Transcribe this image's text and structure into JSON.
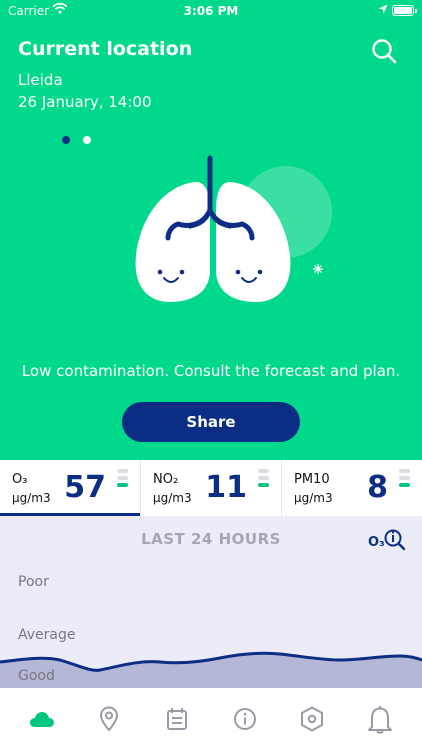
{
  "status_bar": {
    "carrier": "Carrier",
    "time": "3:06 PM"
  },
  "header": {
    "title": "Current location",
    "city": "Lleida",
    "datetime": "26 January, 14:00"
  },
  "pager": {
    "total": 2,
    "active_index": 0
  },
  "message": "Low contamination. Consult the forecast and plan.",
  "share_label": "Share",
  "pollutants": [
    {
      "name": "O₃",
      "unit": "μg/m3",
      "value": "57",
      "active": true
    },
    {
      "name": "NO₂",
      "unit": "μg/m3",
      "value": "11",
      "active": false
    },
    {
      "name": "PM10",
      "unit": "μg/m3",
      "value": "8",
      "active": false
    }
  ],
  "chart": {
    "title": "LAST 24 HOURS",
    "info_label": "O₃",
    "levels": [
      "Poor",
      "Average",
      "Good"
    ]
  },
  "tabbar": [
    "cloud-icon",
    "location-pin-icon",
    "calendar-icon",
    "info-icon",
    "hexagon-icon",
    "bell-icon"
  ],
  "colors": {
    "accent_green": "#00d98b",
    "navy": "#0b2e84",
    "chart_bg": "#ececf9",
    "active_tab": "#00c77f",
    "inactive_tab": "#9a9aa6"
  }
}
